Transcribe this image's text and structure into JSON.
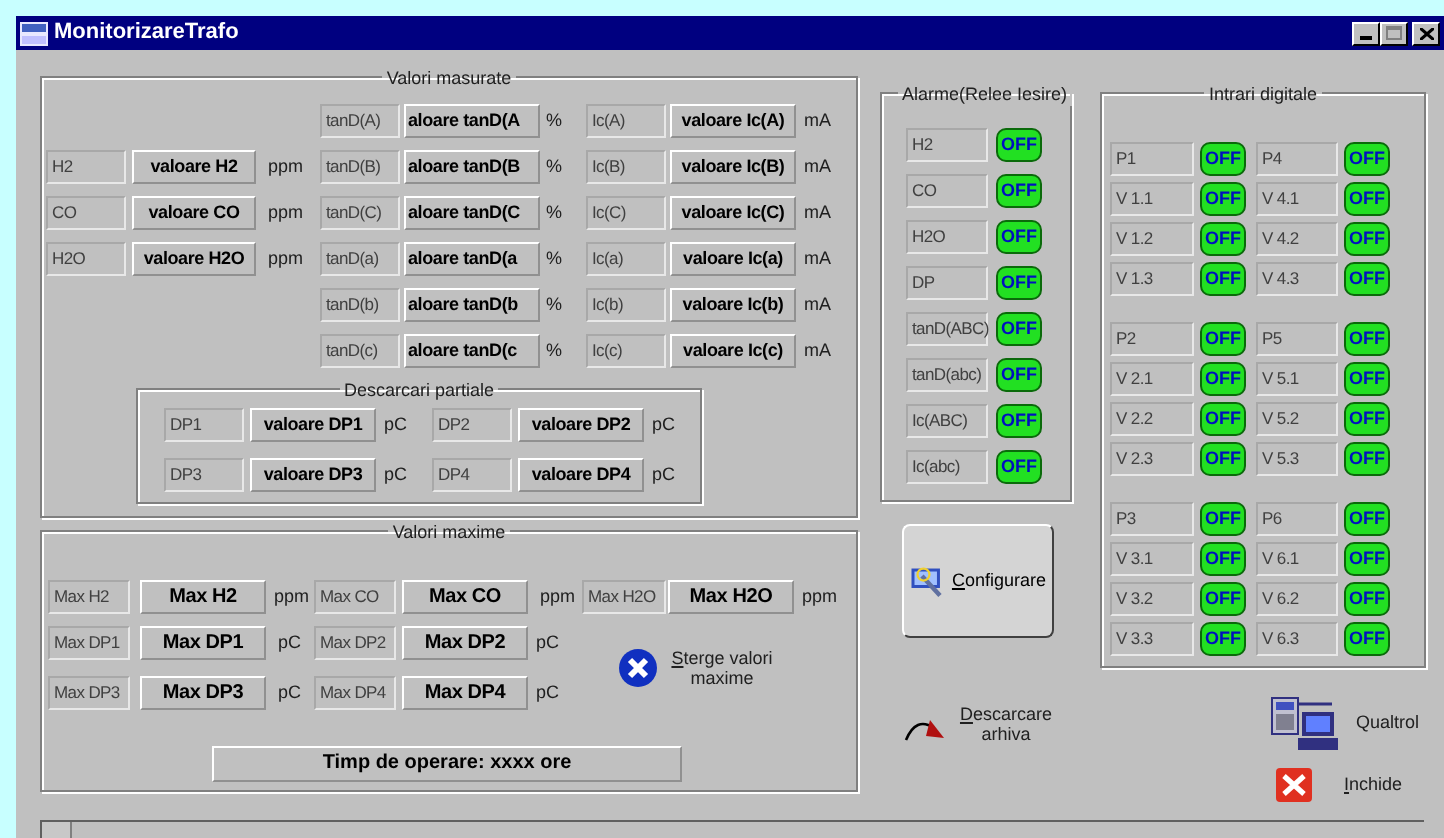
{
  "window": {
    "title": "MonitorizareTrafo"
  },
  "measured": {
    "title": "Valori masurate",
    "gases": [
      {
        "label": "H2",
        "value": "valoare H2",
        "unit": "ppm"
      },
      {
        "label": "CO",
        "value": "valoare CO",
        "unit": "ppm"
      },
      {
        "label": "H2O",
        "value": "valoare H2O",
        "unit": "ppm"
      }
    ],
    "rows": [
      {
        "tand_label": "tanD(A)",
        "tand_value": "aloare tanD(A",
        "tand_unit": "%",
        "ic_label": "Ic(A)",
        "ic_value": "valoare Ic(A)",
        "ic_unit": "mA"
      },
      {
        "tand_label": "tanD(B)",
        "tand_value": "aloare tanD(B",
        "tand_unit": "%",
        "ic_label": "Ic(B)",
        "ic_value": "valoare Ic(B)",
        "ic_unit": "mA"
      },
      {
        "tand_label": "tanD(C)",
        "tand_value": "aloare tanD(C",
        "tand_unit": "%",
        "ic_label": "Ic(C)",
        "ic_value": "valoare Ic(C)",
        "ic_unit": "mA"
      },
      {
        "tand_label": "tanD(a)",
        "tand_value": "aloare tanD(a",
        "tand_unit": "%",
        "ic_label": "Ic(a)",
        "ic_value": "valoare Ic(a)",
        "ic_unit": "mA"
      },
      {
        "tand_label": "tanD(b)",
        "tand_value": "aloare tanD(b",
        "tand_unit": "%",
        "ic_label": "Ic(b)",
        "ic_value": "valoare Ic(b)",
        "ic_unit": "mA"
      },
      {
        "tand_label": "tanD(c)",
        "tand_value": "aloare tanD(c",
        "tand_unit": "%",
        "ic_label": "Ic(c)",
        "ic_value": "valoare Ic(c)",
        "ic_unit": "mA"
      }
    ],
    "partial": {
      "title": "Descarcari partiale",
      "items": [
        {
          "label": "DP1",
          "value": "valoare DP1",
          "unit": "pC"
        },
        {
          "label": "DP2",
          "value": "valoare DP2",
          "unit": "pC"
        },
        {
          "label": "DP3",
          "value": "valoare DP3",
          "unit": "pC"
        },
        {
          "label": "DP4",
          "value": "valoare DP4",
          "unit": "pC"
        }
      ]
    }
  },
  "alarms": {
    "title": "Alarme(Relee Iesire)",
    "items": [
      {
        "label": "H2",
        "state": "OFF",
        "on": false
      },
      {
        "label": "CO",
        "state": "OFF",
        "on": false
      },
      {
        "label": "H2O",
        "state": "OFF",
        "on": false
      },
      {
        "label": "DP",
        "state": "OFF",
        "on": false
      },
      {
        "label": "tanD(ABC)",
        "state": "OFF",
        "on": false
      },
      {
        "label": "tanD(abc)",
        "state": "OFF",
        "on": false
      },
      {
        "label": "Ic(ABC)",
        "state": "OFF",
        "on": false
      },
      {
        "label": "Ic(abc)",
        "state": "OFF",
        "on": false
      }
    ]
  },
  "digital_inputs": {
    "title": "Intrari digitale",
    "groups": [
      {
        "left": [
          {
            "label": "P1",
            "state": "OFF",
            "on": false
          },
          {
            "label": "V 1.1",
            "state": "OFF",
            "on": false
          },
          {
            "label": "V 1.2",
            "state": "OFF",
            "on": false
          },
          {
            "label": "V 1.3",
            "state": "OFF",
            "on": false
          }
        ],
        "right": [
          {
            "label": "P4",
            "state": "OFF",
            "on": false
          },
          {
            "label": "V 4.1",
            "state": "OFF",
            "on": false
          },
          {
            "label": "V 4.2",
            "state": "OFF",
            "on": false
          },
          {
            "label": "V 4.3",
            "state": "OFF",
            "on": false
          }
        ]
      },
      {
        "left": [
          {
            "label": "P2",
            "state": "OFF",
            "on": false
          },
          {
            "label": "V 2.1",
            "state": "OFF",
            "on": false
          },
          {
            "label": "V 2.2",
            "state": "OFF",
            "on": false
          },
          {
            "label": "V 2.3",
            "state": "OFF",
            "on": false
          }
        ],
        "right": [
          {
            "label": "P5",
            "state": "OFF",
            "on": false
          },
          {
            "label": "V 5.1",
            "state": "OFF",
            "on": false
          },
          {
            "label": "V 5.2",
            "state": "OFF",
            "on": false
          },
          {
            "label": "V 5.3",
            "state": "OFF",
            "on": false
          }
        ]
      },
      {
        "left": [
          {
            "label": "P3",
            "state": "OFF",
            "on": false
          },
          {
            "label": "V 3.1",
            "state": "OFF",
            "on": false
          },
          {
            "label": "V 3.2",
            "state": "OFF",
            "on": false
          },
          {
            "label": "V 3.3",
            "state": "OFF",
            "on": false
          }
        ],
        "right": [
          {
            "label": "P6",
            "state": "OFF",
            "on": false
          },
          {
            "label": "V 6.1",
            "state": "OFF",
            "on": false
          },
          {
            "label": "V 6.2",
            "state": "OFF",
            "on": false
          },
          {
            "label": "V 6.3",
            "state": "OFF",
            "on": false
          }
        ]
      }
    ]
  },
  "maximum": {
    "title": "Valori maxime",
    "items": [
      {
        "label": "Max H2",
        "value": "Max H2",
        "unit": "ppm"
      },
      {
        "label": "Max CO",
        "value": "Max CO",
        "unit": "ppm"
      },
      {
        "label": "Max H2O",
        "value": "Max H2O",
        "unit": "ppm"
      },
      {
        "label": "Max DP1",
        "value": "Max DP1",
        "unit": "pC"
      },
      {
        "label": "Max DP2",
        "value": "Max DP2",
        "unit": "pC"
      },
      {
        "label": "Max DP3",
        "value": "Max DP3",
        "unit": "pC"
      },
      {
        "label": "Max DP4",
        "value": "Max DP4",
        "unit": "pC"
      }
    ],
    "clear_button": "Sterge valori maxime",
    "operating_time": "Timp de operare: xxxx ore"
  },
  "actions": {
    "configure": "Configurare",
    "download": "Descarcare arhiva",
    "brand": "Qualtrol",
    "close": "Inchide"
  }
}
